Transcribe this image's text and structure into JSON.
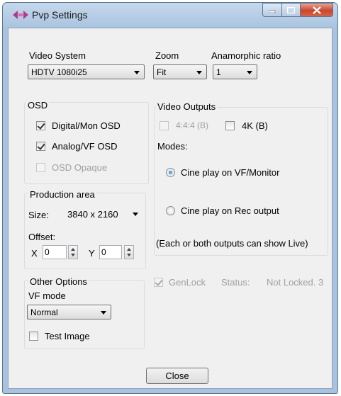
{
  "window": {
    "title": "Pvp Settings"
  },
  "video_system": {
    "label": "Video System",
    "value": "HDTV 1080i25"
  },
  "zoom": {
    "label": "Zoom",
    "value": "Fit"
  },
  "anamorphic": {
    "label": "Anamorphic ratio",
    "value": "1"
  },
  "osd": {
    "label": "OSD",
    "digital": {
      "label": "Digital/Mon OSD",
      "checked": true,
      "enabled": true
    },
    "analog": {
      "label": "Analog/VF OSD",
      "checked": true,
      "enabled": true
    },
    "opaque": {
      "label": "OSD Opaque",
      "checked": false,
      "enabled": false
    }
  },
  "production_area": {
    "label": "Production area",
    "size_label": "Size:",
    "size_value": "3840 x 2160",
    "offset_label": "Offset:",
    "x_label": "X",
    "x_value": "0",
    "y_label": "Y",
    "y_value": "0"
  },
  "other_options": {
    "label": "Other Options",
    "vf_mode_label": "VF mode",
    "vf_mode_value": "Normal",
    "test_image": {
      "label": "Test Image",
      "checked": false
    }
  },
  "video_outputs": {
    "label": "Video Outputs",
    "opt_444": {
      "label": "4:4:4 (B)",
      "checked": false,
      "enabled": false
    },
    "opt_4k": {
      "label": "4K (B)",
      "checked": false,
      "enabled": true
    },
    "modes_label": "Modes:",
    "mode_vf": {
      "label": "Cine play on VF/Monitor",
      "selected": true
    },
    "mode_rec": {
      "label": "Cine play on Rec output",
      "selected": false
    },
    "note": "(Each or both outputs can show Live)"
  },
  "genlock": {
    "label": "GenLock",
    "checked": true,
    "enabled": false,
    "status_label": "Status:",
    "status_value": "Not Locked. 3"
  },
  "close_label": "Close",
  "colors": {
    "title_close": "#c9462c",
    "radio_selected": "#1a5fb4",
    "frame": "#a9c3df"
  }
}
